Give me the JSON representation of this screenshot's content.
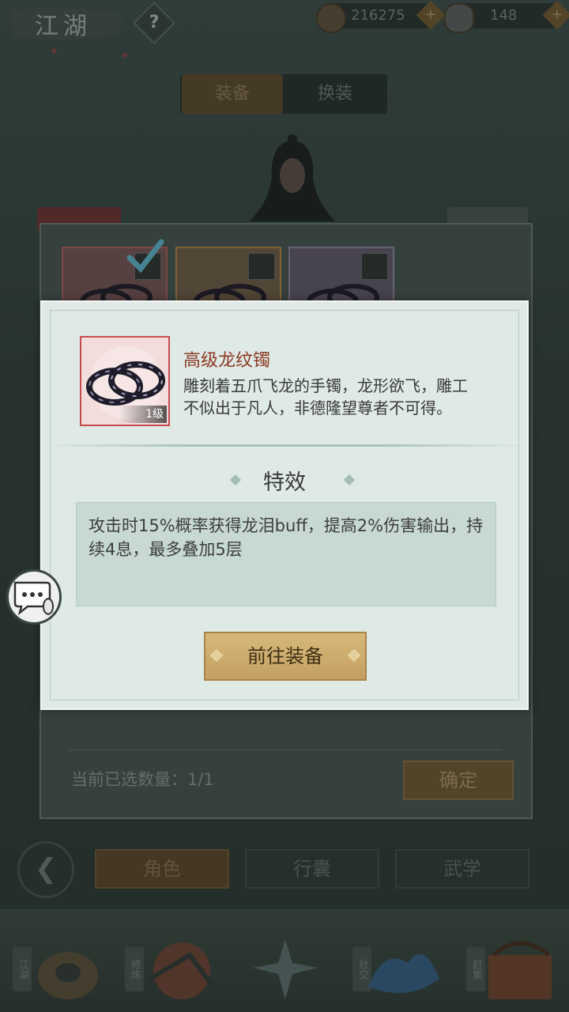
{
  "top_bar": {
    "title": "江湖",
    "help_label": "?",
    "coins": "216275",
    "silver": "148",
    "plus": "+"
  },
  "tabs": {
    "equip": "装备",
    "outfit": "换装"
  },
  "selection_panel": {
    "selected_count_label": "当前已选数量：1/1",
    "confirm_label": "确定"
  },
  "bottom_nav": {
    "role": "角色",
    "bag": "行囊",
    "martial": "武学",
    "dock_labels": [
      "江湖",
      "修炼",
      "社交",
      "赶集"
    ]
  },
  "dialog": {
    "item_name": "高级龙纹镯",
    "item_level": "1级",
    "item_desc": "雕刻着五爪飞龙的手镯，龙形欲飞，雕工不似出于凡人，非德隆望尊者不可得。",
    "effect_title": "特效",
    "effect_text": "攻击时15%概率获得龙泪buff，提高2%伤害输出，持续4息，最多叠加5层",
    "goto_button": "前往装备"
  },
  "colors": {
    "dialog_bg": "#dfe9e6",
    "item_name": "#8d3b24",
    "button_gold": "#d6b97a",
    "rarity_red": "#c84b4b"
  }
}
